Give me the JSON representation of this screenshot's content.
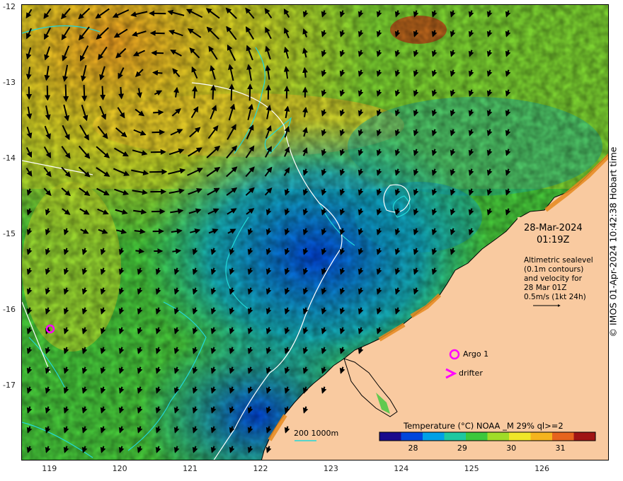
{
  "map": {
    "lon_ticks": [
      "119",
      "120",
      "121",
      "122",
      "123",
      "124",
      "125",
      "126"
    ],
    "lat_ticks": [
      "-12",
      "-13",
      "-14",
      "-15",
      "-16",
      "-17"
    ],
    "lon_range": [
      118.6,
      126.95
    ],
    "lat_range": [
      -11.95,
      -17.98
    ],
    "land_color": "#f9caa0",
    "contour_colors": {
      "200m": "#22d8d8",
      "1000m": "#ffffff"
    }
  },
  "annotations": {
    "date": "28-Mar-2024",
    "time": "01:19Z",
    "info_lines": [
      "Altimetric sealevel",
      "(0.1m contours)",
      "and velocity for",
      "28 Mar 01Z",
      "0.5m/s (1kt 24h)"
    ],
    "contour_legend": "200  1000m",
    "argo_label": "Argo 1",
    "drifter_label": "drifter",
    "marker_color": "#ff00ff"
  },
  "colorbar": {
    "title": "Temperature (°C) NOAA _M 29% ql>=2",
    "ticks": [
      "28",
      "29",
      "30",
      "31"
    ],
    "range": [
      27.3,
      31.7
    ],
    "colors": [
      "#1a0a8c",
      "#0046dc",
      "#00a0e6",
      "#1ec8a0",
      "#3cc83c",
      "#a0dc28",
      "#f0e628",
      "#f5b41e",
      "#e6641e",
      "#a01414"
    ]
  },
  "credit": "© IMOS 01-Apr-2024 10:42:38 Hobart time"
}
